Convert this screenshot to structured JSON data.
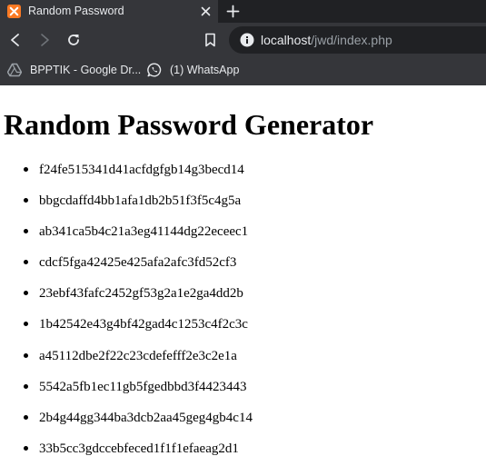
{
  "browser": {
    "tab_title": "Random Password",
    "url_host": "localhost",
    "url_path": "/jwd/index.php",
    "bookmarks": [
      {
        "label": "BPPTIK - Google Dr...",
        "icon": "google-drive-icon"
      },
      {
        "label": "(1) WhatsApp",
        "icon": "whatsapp-icon"
      }
    ],
    "colors": {
      "tab_strip": "#202124",
      "toolbar": "#35363a",
      "omnibox": "#202124",
      "text": "#e8eaed",
      "muted_text": "#9aa0a6"
    }
  },
  "page": {
    "heading": "Random Password Generator",
    "passwords": [
      "f24fe515341d41acfdgfgb14g3becd14",
      "bbgcdaffd4bb1afa1db2b51f3f5c4g5a",
      "ab341ca5b4c21a3eg41144dg22eceec1",
      "cdcf5fga42425e425afa2afc3fd52cf3",
      "23ebf43fafc2452gf53g2a1e2ga4dd2b",
      "1b42542e43g4bf42gad4c1253c4f2c3c",
      "a45112dbe2f22c23cdefefff2e3c2e1a",
      "5542a5fb1ec11gb5fgedbbd3f4423443",
      "2b4g44gg344ba3dcb2aa45geg4gb4c14",
      "33b5cc3gdccebfeced1f1f1efaeag2d1"
    ]
  }
}
